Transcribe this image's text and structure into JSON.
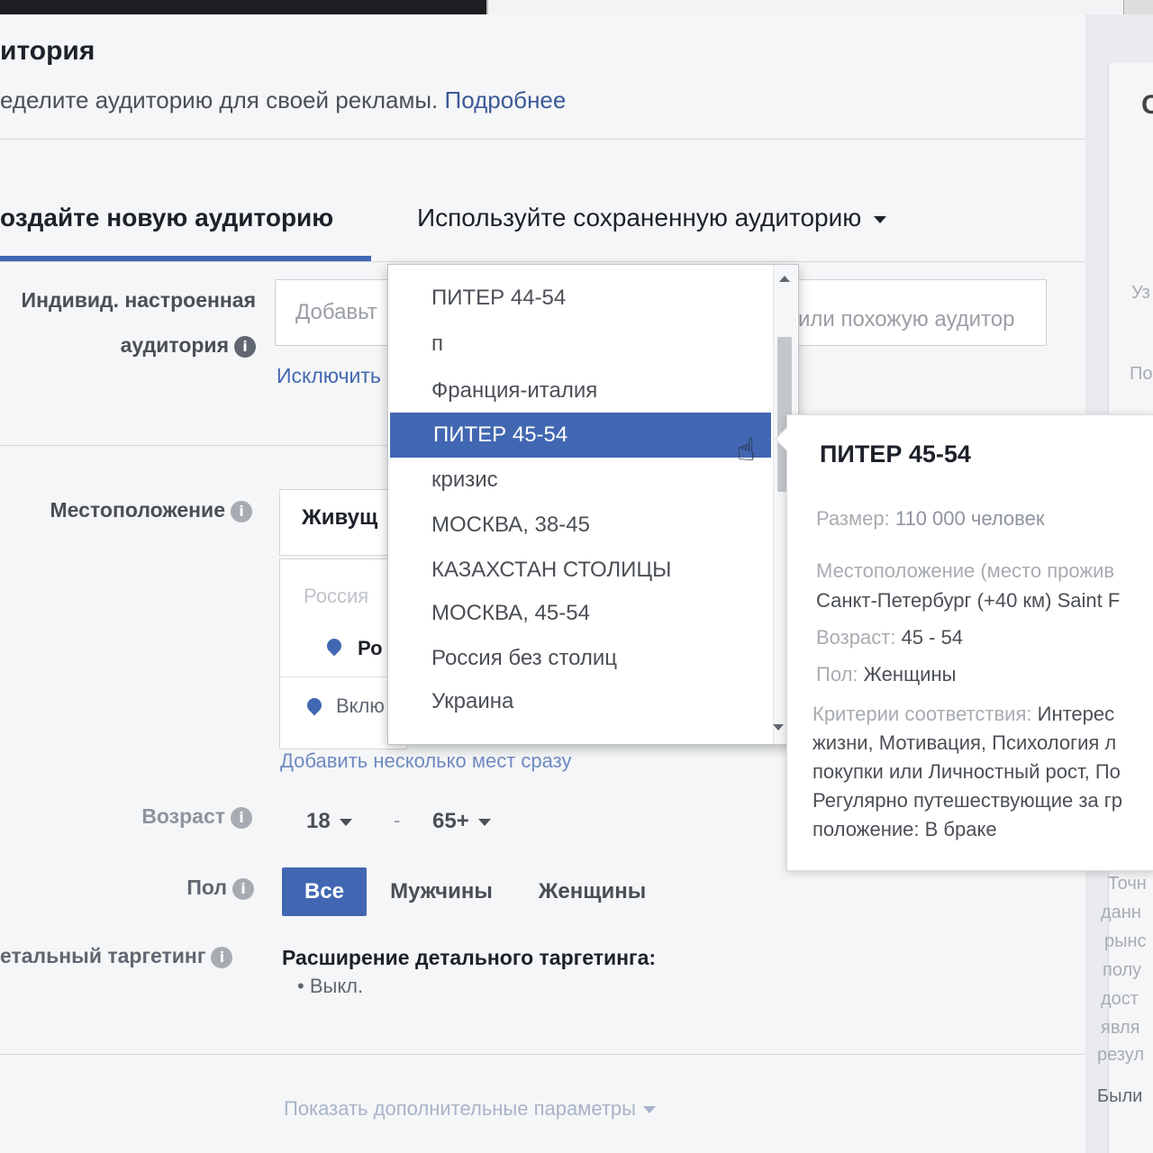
{
  "header": {
    "title": "итория",
    "subtitle": "еделите аудиторию для своей рекламы.",
    "learn_more": "Подробнее"
  },
  "tabs": {
    "create": "оздайте новую аудиторию",
    "saved": "Используйте сохраненную аудиторию"
  },
  "custom_audience": {
    "label_line1": "Индивид. настроенная",
    "label_line2": "аудитория",
    "input_placeholder_left": "Добавьт",
    "input_placeholder_right": "или похожую аудитор",
    "exclude_link": "Исключить"
  },
  "location": {
    "label": "Местоположение",
    "type_value": "Живущ",
    "search_placeholder": "Россия",
    "selected_country": "Ро",
    "include_label": "Вклю",
    "add_multiple_link": "Добавить несколько мест сразу"
  },
  "age": {
    "label": "Возраст",
    "min": "18",
    "separator": "-",
    "max": "65+"
  },
  "gender": {
    "label": "Пол",
    "options": [
      "Все",
      "Мужчины",
      "Женщины"
    ],
    "selected": "Все"
  },
  "detailed_targeting": {
    "label": "етальный таргетинг",
    "expansion_title": "Расширение детального таргетинга:",
    "expansion_value": "Выкл."
  },
  "show_more": "Показать дополнительные параметры",
  "saved_audience_dropdown": {
    "items": [
      "ПИТЕР 44-54",
      "п",
      "Франция-италия",
      "ПИТЕР 45-54",
      "кризис",
      "МОСКВА, 38-45",
      "КАЗАХСТАН СТОЛИЦЫ",
      "МОСКВА, 45-54",
      "Россия без столиц",
      "Украина"
    ],
    "highlighted": "ПИТЕР 45-54"
  },
  "tooltip": {
    "title": "ПИТЕР 45-54",
    "size_key": "Размер:",
    "size_value": "110 000 человек",
    "location_key": "Местоположение (место прожив",
    "location_value": "Санкт-Петербург (+40 км) Saint F",
    "age_key": "Возраст:",
    "age_value": "45 - 54",
    "gender_key": "Пол:",
    "gender_value": "Женщины",
    "criteria_key": "Критерии соответствия:",
    "criteria_lines": [
      "Интерес",
      "жизни, Мотивация, Психология л",
      "покупки или Личностный рост, По",
      "Регулярно путешествующие за гр",
      "положение: В браке"
    ]
  },
  "right_column": {
    "top_c": "С",
    "line1": "Уз",
    "line2": "По",
    "bottom_lines": [
      "Точн",
      "данн",
      "рынс",
      "полу",
      "дост",
      "явля",
      "резул",
      "Были"
    ]
  },
  "colors": {
    "accent": "#4267b2",
    "link": "#3b5998",
    "background": "#f5f6f7"
  }
}
